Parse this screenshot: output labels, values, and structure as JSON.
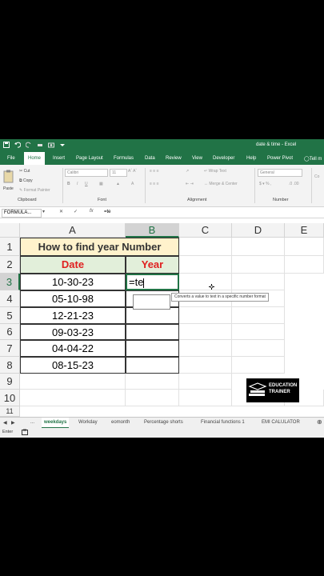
{
  "titlebar": {
    "title": "date & time - Excel"
  },
  "tabs": [
    "File",
    "Home",
    "Insert",
    "Page Layout",
    "Formulas",
    "Data",
    "Review",
    "View",
    "Developer",
    "Help",
    "Power Pivot",
    "Tell m"
  ],
  "ribbon": {
    "paste": "Paste",
    "cut": "Cut",
    "copy": "Copy",
    "format_painter": "Format Painter",
    "font_name": "Calibri",
    "font_size": "11",
    "wrap_text": "Wrap Text",
    "merge_center": "Merge & Center",
    "number_format": "General",
    "groups": {
      "clipboard": "Clipboard",
      "font": "Font",
      "alignment": "Alignment",
      "number": "Number"
    }
  },
  "formula_bar": {
    "name_box": "FORMULA...",
    "fx": "fx",
    "formula": "=te"
  },
  "columns": [
    "A",
    "B",
    "C",
    "D",
    "E"
  ],
  "rows": [
    "1",
    "2",
    "3",
    "4",
    "5",
    "6",
    "7",
    "8",
    "9",
    "10",
    "11"
  ],
  "sheet": {
    "title": "How to find year Number",
    "header_date": "Date",
    "header_year": "Year",
    "dates": [
      "10-30-23",
      "05-10-98",
      "12-21-23",
      "09-03-23",
      "04-04-22",
      "08-15-23"
    ],
    "active_cell_text": "=te"
  },
  "tooltip": "Converts a value to text in a specific number format",
  "logo": {
    "line1": "EDUCATION",
    "line2": "TRAINER"
  },
  "sheet_tabs": [
    "weekdays",
    "Workday",
    "eomonth",
    "Percentage shorts",
    "Financial functions 1",
    "EMI CALULATOR"
  ],
  "sheet_nav": {
    "ellipsis": "..."
  },
  "status": {
    "mode": "Enter"
  },
  "colors": {
    "excel_green": "#217346",
    "title_fill": "#fff2cc",
    "header_fill": "#e2efda",
    "header_text": "#e02020"
  }
}
